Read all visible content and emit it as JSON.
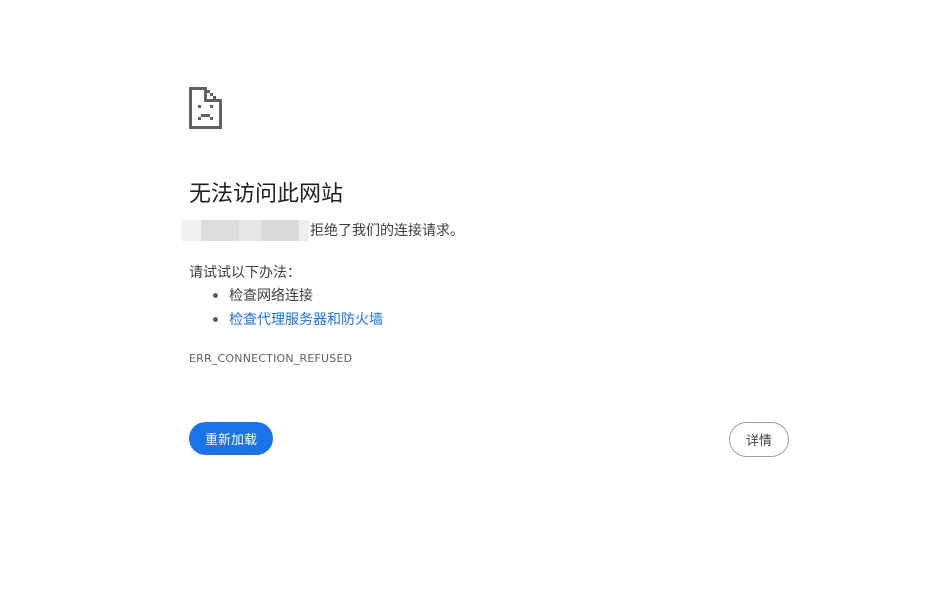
{
  "error_icon": {
    "icon": "sad-page-icon",
    "color": "#5f6368"
  },
  "title": "无法访问此网站",
  "subline": {
    "host_redacted": true,
    "message": "拒绝了我们的连接请求。"
  },
  "suggestions": {
    "heading": "请试试以下办法：",
    "items": [
      {
        "label": "检查网络连接",
        "is_link": false
      },
      {
        "label": "检查代理服务器和防火墙",
        "is_link": true
      }
    ]
  },
  "error_code": "ERR_CONNECTION_REFUSED",
  "buttons": {
    "reload_label": "重新加载",
    "details_label": "详情"
  },
  "colors": {
    "accent": "#1a73e8",
    "text": "#202124",
    "secondary_text": "#5f6368"
  }
}
